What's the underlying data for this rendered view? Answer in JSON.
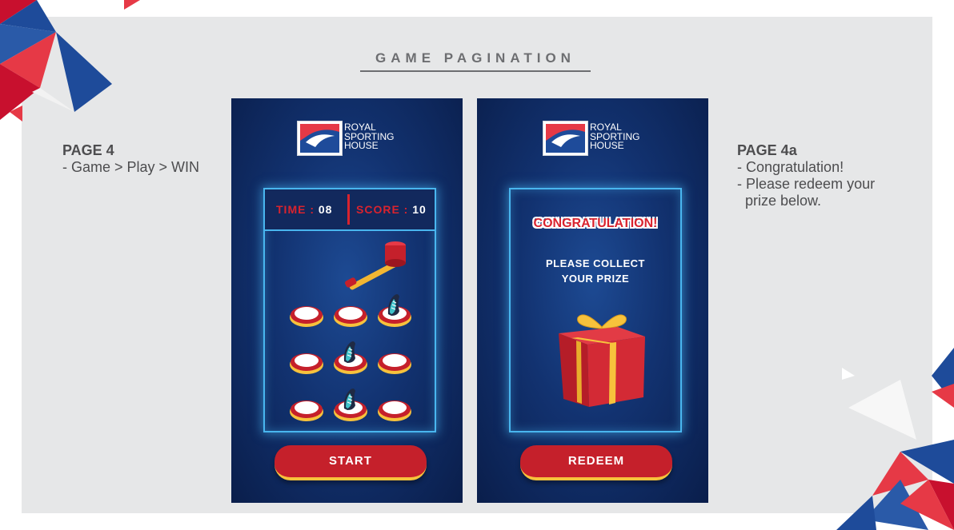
{
  "header": {
    "title": "GAME PAGINATION"
  },
  "left_note": {
    "heading": "PAGE 4",
    "lines": [
      "- Game > Play > WIN"
    ]
  },
  "right_note": {
    "heading": "PAGE 4a",
    "lines": [
      "- Congratulation!",
      "- Please redeem your",
      "  prize below."
    ]
  },
  "brand": {
    "name_lines": [
      "ROYAL",
      "SPORTING",
      "HOUSE"
    ]
  },
  "game_screen": {
    "time_label": "TIME : ",
    "time_value": "08",
    "score_label": "SCORE : ",
    "score_value": "10",
    "button_label": "START",
    "holes": [
      {
        "shoe": false
      },
      {
        "shoe": false
      },
      {
        "shoe": true
      },
      {
        "shoe": false
      },
      {
        "shoe": true
      },
      {
        "shoe": false
      },
      {
        "shoe": false
      },
      {
        "shoe": true
      },
      {
        "shoe": false
      }
    ]
  },
  "prize_screen": {
    "headline": "CONGRATULATION!",
    "message_lines": [
      "PLEASE COLLECT",
      "YOUR PRIZE"
    ],
    "button_label": "REDEEM"
  },
  "colors": {
    "brand_red": "#d9232e",
    "brand_blue": "#1e4b9a",
    "neon_frame": "#49b6ef",
    "button_gold": "#f7c23c",
    "background_panel": "#e6e7e8"
  },
  "icons": [
    "brand-logo-icon",
    "mallet-icon",
    "hole-icon",
    "shoe-icon",
    "gift-box-icon",
    "decorative-triangles"
  ]
}
